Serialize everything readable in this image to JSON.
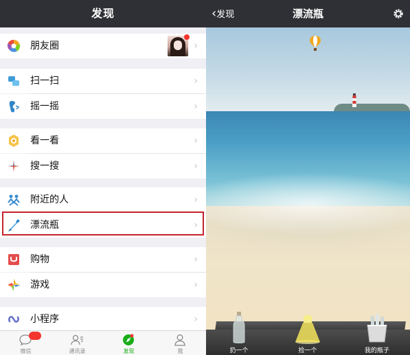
{
  "left": {
    "header_title": "发现",
    "menu": [
      {
        "id": "moments",
        "label": "朋友圈",
        "icon": "moments-aperture-icon"
      },
      {
        "id": "scan",
        "label": "扫一扫",
        "icon": "scan-icon"
      },
      {
        "id": "shake",
        "label": "摇一摇",
        "icon": "shake-icon"
      },
      {
        "id": "top-stories",
        "label": "看一看",
        "icon": "top-stories-icon"
      },
      {
        "id": "search",
        "label": "搜一搜",
        "icon": "search-star-icon"
      },
      {
        "id": "nearby",
        "label": "附近的人",
        "icon": "people-nearby-icon"
      },
      {
        "id": "drift-bottle",
        "label": "漂流瓶",
        "icon": "drift-bottle-icon"
      },
      {
        "id": "shopping",
        "label": "购物",
        "icon": "shopping-bag-icon"
      },
      {
        "id": "games",
        "label": "游戏",
        "icon": "games-icon"
      },
      {
        "id": "mini-programs",
        "label": "小程序",
        "icon": "mini-program-icon"
      }
    ],
    "chevron": "›",
    "tabs": [
      {
        "label": "微信",
        "icon": "chat-bubble-icon"
      },
      {
        "label": "通讯录",
        "icon": "contacts-icon"
      },
      {
        "label": "发现",
        "icon": "discover-compass-icon"
      },
      {
        "label": "我",
        "icon": "me-person-icon"
      }
    ],
    "colors": {
      "topbar": "#2f3035",
      "highlight_border": "#c4232b",
      "active_tab": "#1aad19",
      "badge": "#f43530"
    }
  },
  "right": {
    "header_title": "漂流瓶",
    "back_label": "发现",
    "back_glyph": "‹",
    "actions": [
      {
        "label": "扔一个",
        "icon": "throw-bottle-icon"
      },
      {
        "label": "捡一个",
        "icon": "pick-bottle-icon"
      },
      {
        "label": "我的瓶子",
        "icon": "my-bottles-bucket-icon"
      }
    ]
  }
}
